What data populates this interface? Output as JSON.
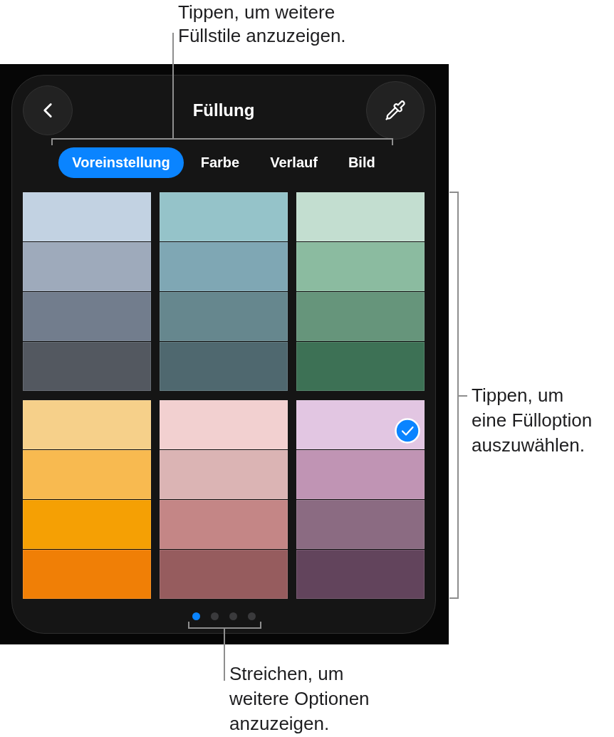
{
  "callouts": [
    {
      "kind": "top",
      "lines": [
        "Tippen, um weitere",
        "Füllstile anzuzeigen."
      ]
    },
    {
      "kind": "right",
      "lines": [
        "Tippen, um",
        "eine Fülloption",
        "auszuwählen."
      ]
    },
    {
      "kind": "bottom",
      "lines": [
        "Streichen, um",
        "weitere Optionen",
        "anzuzeigen."
      ]
    }
  ],
  "panel": {
    "title": "Füllung",
    "tabs": [
      {
        "label": "Voreinstellung",
        "selected": true
      },
      {
        "label": "Farbe",
        "selected": false
      },
      {
        "label": "Verlauf",
        "selected": false
      },
      {
        "label": "Bild",
        "selected": false
      }
    ],
    "swatch_groups": [
      {
        "swatches": [
          {
            "color": "#c2d2e2",
            "selected": false
          },
          {
            "color": "#9eaabb",
            "selected": false
          },
          {
            "color": "#727d8d",
            "selected": false
          },
          {
            "color": "#535860",
            "selected": false
          }
        ]
      },
      {
        "swatches": [
          {
            "color": "#95c3c9",
            "selected": false
          },
          {
            "color": "#7fa7b4",
            "selected": false
          },
          {
            "color": "#66878e",
            "selected": false
          },
          {
            "color": "#4f686f",
            "selected": false
          }
        ]
      },
      {
        "swatches": [
          {
            "color": "#c3ded0",
            "selected": false
          },
          {
            "color": "#8bbba0",
            "selected": false
          },
          {
            "color": "#66957b",
            "selected": false
          },
          {
            "color": "#3d7155",
            "selected": false
          }
        ]
      },
      {
        "swatches": [
          {
            "color": "#f6d08a",
            "selected": false
          },
          {
            "color": "#f8ba50",
            "selected": false
          },
          {
            "color": "#f5a004",
            "selected": false
          },
          {
            "color": "#f07f06",
            "selected": false
          }
        ]
      },
      {
        "swatches": [
          {
            "color": "#f2d0d0",
            "selected": false
          },
          {
            "color": "#dbb4b4",
            "selected": false
          },
          {
            "color": "#c48686",
            "selected": false
          },
          {
            "color": "#965c5e",
            "selected": false
          }
        ]
      },
      {
        "swatches": [
          {
            "color": "#e2c6e2",
            "selected": true
          },
          {
            "color": "#c094b4",
            "selected": false
          },
          {
            "color": "#8b6b82",
            "selected": false
          },
          {
            "color": "#62445c",
            "selected": false
          }
        ]
      }
    ],
    "page_dots": [
      {
        "selected": true
      },
      {
        "selected": false
      },
      {
        "selected": false
      },
      {
        "selected": false
      }
    ]
  }
}
